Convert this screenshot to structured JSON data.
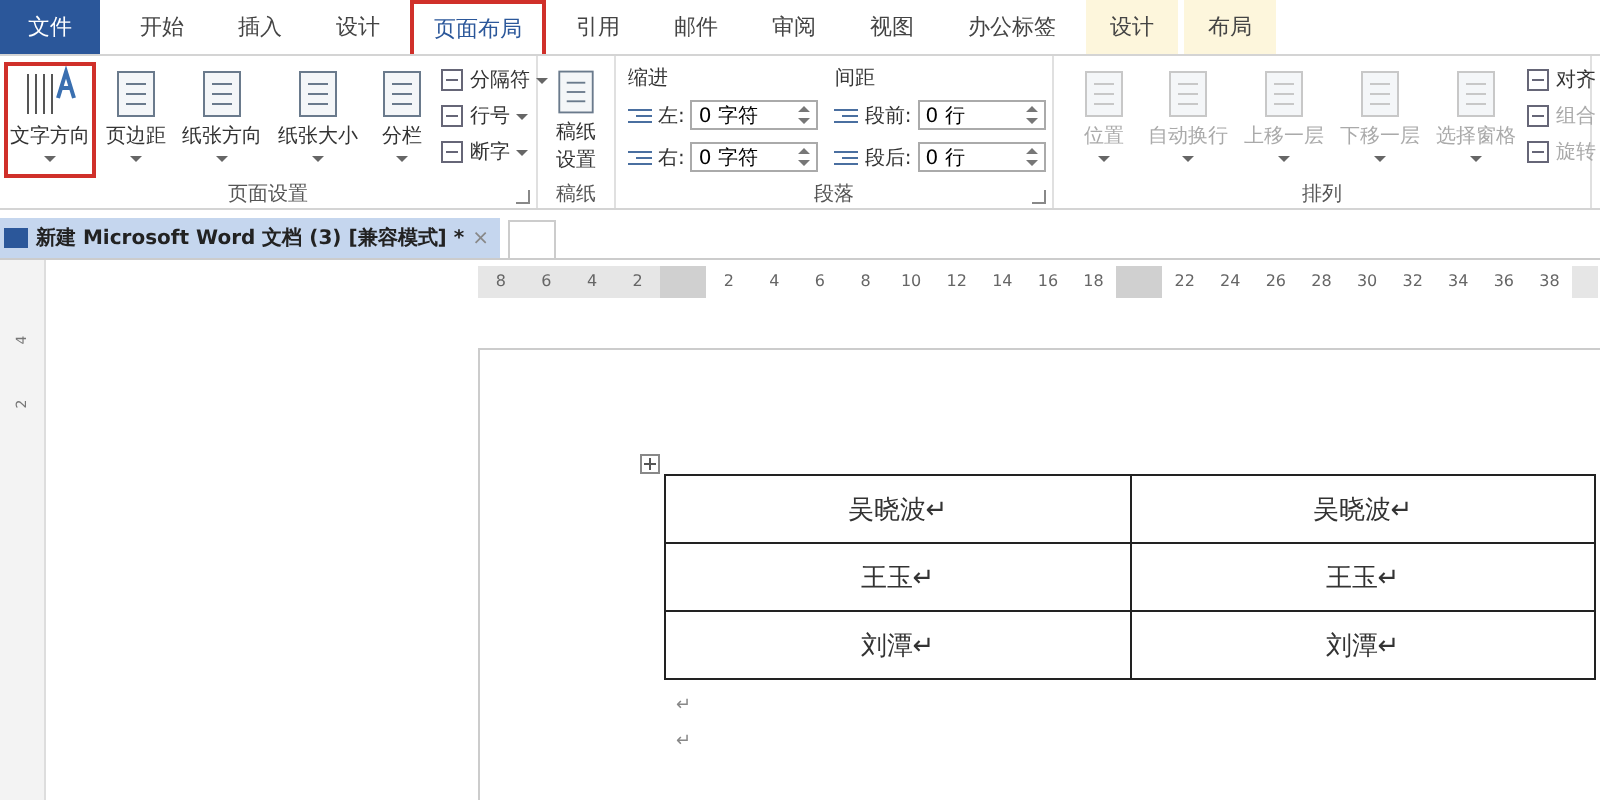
{
  "menu_tabs": [
    {
      "label": "文件",
      "kind": "file",
      "selected": false,
      "highlighted": false
    },
    {
      "label": "开始",
      "kind": "normal",
      "selected": false,
      "highlighted": false
    },
    {
      "label": "插入",
      "kind": "normal",
      "selected": false,
      "highlighted": false
    },
    {
      "label": "设计",
      "kind": "normal",
      "selected": false,
      "highlighted": false
    },
    {
      "label": "页面布局",
      "kind": "normal",
      "selected": true,
      "highlighted": true
    },
    {
      "label": "引用",
      "kind": "normal",
      "selected": false,
      "highlighted": false
    },
    {
      "label": "邮件",
      "kind": "normal",
      "selected": false,
      "highlighted": false
    },
    {
      "label": "审阅",
      "kind": "normal",
      "selected": false,
      "highlighted": false
    },
    {
      "label": "视图",
      "kind": "normal",
      "selected": false,
      "highlighted": false
    },
    {
      "label": "办公标签",
      "kind": "normal",
      "selected": false,
      "highlighted": false
    },
    {
      "label": "设计",
      "kind": "contextual",
      "selected": false,
      "highlighted": false
    },
    {
      "label": "布局",
      "kind": "contextual",
      "selected": false,
      "highlighted": false
    }
  ],
  "page_setup": {
    "label": "页面设置",
    "large_buttons": [
      {
        "label": "文字方向",
        "highlighted": true
      },
      {
        "label": "页边距",
        "highlighted": false
      },
      {
        "label": "纸张方向",
        "highlighted": false
      },
      {
        "label": "纸张大小",
        "highlighted": false
      },
      {
        "label": "分栏",
        "highlighted": false
      }
    ],
    "small_buttons": [
      {
        "label": "分隔符"
      },
      {
        "label": "行号"
      },
      {
        "label": "断字"
      }
    ]
  },
  "manuscript": {
    "label": "稿纸",
    "button": [
      "稿纸",
      "设置"
    ]
  },
  "paragraph": {
    "label": "段落",
    "indent": {
      "label": "缩进",
      "fields": [
        {
          "label": "左:",
          "value": "0 字符"
        },
        {
          "label": "右:",
          "value": "0 字符"
        }
      ]
    },
    "spacing": {
      "label": "间距",
      "fields": [
        {
          "label": "段前:",
          "value": "0 行"
        },
        {
          "label": "段后:",
          "value": "0 行"
        }
      ]
    }
  },
  "arrange": {
    "label": "排列",
    "large_buttons": [
      {
        "label": "位置",
        "disabled": true
      },
      {
        "label": "自动换行",
        "disabled": true
      },
      {
        "label": "上移一层",
        "disabled": true
      },
      {
        "label": "下移一层",
        "disabled": true
      },
      {
        "label": "选择窗格",
        "disabled": true
      }
    ],
    "small_buttons": [
      {
        "label": "对齐",
        "disabled": false
      },
      {
        "label": "组合",
        "disabled": true
      },
      {
        "label": "旋转",
        "disabled": true
      }
    ]
  },
  "document_tab": {
    "title": "新建 Microsoft Word 文档 (3) [兼容模式] *",
    "close": "×"
  },
  "ruler": {
    "left_numbers": [
      "8",
      "6",
      "4",
      "2"
    ],
    "middle_numbers": [
      "2",
      "4",
      "6",
      "8",
      "10",
      "12",
      "14",
      "16",
      "18"
    ],
    "right_numbers": [
      "22",
      "24",
      "26",
      "28",
      "30",
      "32",
      "34",
      "36",
      "38"
    ]
  },
  "vertical_ruler": {
    "numbers": [
      "4",
      "2"
    ]
  },
  "table": {
    "rows": [
      [
        "吴晓波↵",
        "吴晓波↵"
      ],
      [
        "王玉↵",
        "王玉↵"
      ],
      [
        "刘潭↵",
        "刘潭↵"
      ]
    ]
  },
  "paragraph_marks": [
    "↵",
    "↵"
  ]
}
